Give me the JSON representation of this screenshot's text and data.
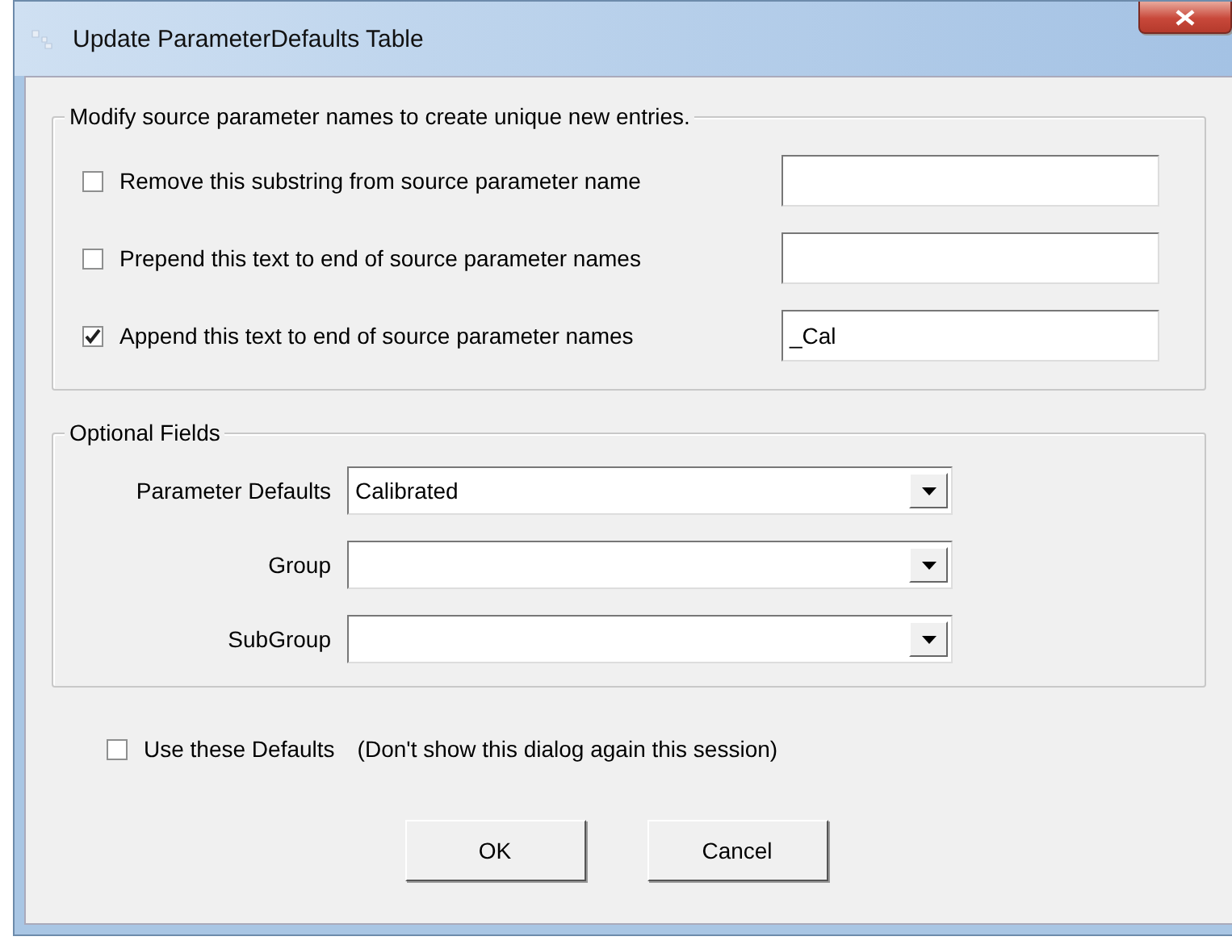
{
  "window": {
    "title": "Update ParameterDefaults Table"
  },
  "rename_group": {
    "title": "Modify source parameter names to create unique new entries.",
    "rows": [
      {
        "label": "Remove this substring from source parameter name",
        "checked": false
      },
      {
        "label": "Prepend this text to end of source parameter names",
        "checked": false
      },
      {
        "label": "Append this text to end of source parameter names",
        "checked": true,
        "value": "_Cal"
      }
    ]
  },
  "optional_group": {
    "title": "Optional Fields",
    "fields": [
      {
        "label": "Parameter Defaults",
        "value": "Calibrated"
      },
      {
        "label": "Group"
      },
      {
        "label": "SubGroup"
      }
    ]
  },
  "use_defaults": {
    "label": "Use these Defaults",
    "note": "(Don't show this dialog again this session)",
    "checked": false
  },
  "buttons": [
    "OK",
    "Cancel"
  ]
}
